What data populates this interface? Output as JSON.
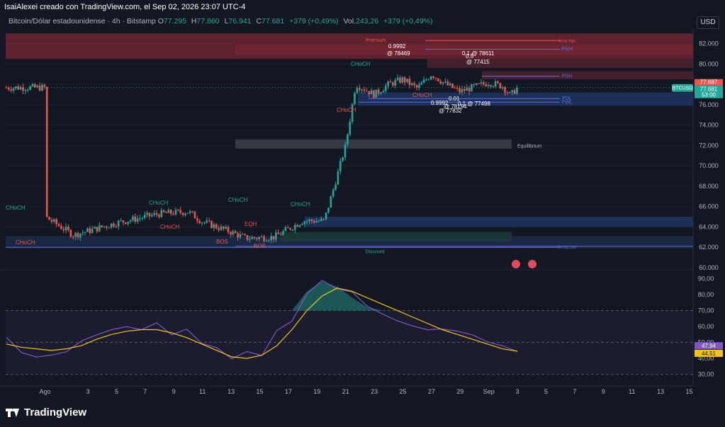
{
  "header": {
    "caption": "IsaiAlexei creado con TradingView.com, el Sep 02, 2026 23:07 UTC-4",
    "symbol": "Bitcoin/Dólar estadounidense · 4h · Bitstamp",
    "o_label": "O",
    "o_value": "77.295",
    "h_label": "H",
    "h_value": "77.860",
    "l_label": "L",
    "l_value": "76.941",
    "c_label": "C",
    "c_value": "77.681",
    "change": "+379 (+0,49%)",
    "vol_label": "Vol.",
    "vol_value": "243,26",
    "vol_change": "+379 (+0,49%)",
    "currency_button": "USD"
  },
  "colors": {
    "background": "#131722",
    "up": "#26a69a",
    "down": "#ef5350",
    "rsi_line": "#7e57c2",
    "rsi_ma": "#f0c419",
    "premium_zone": "#7a2631",
    "discount_zone": "#1c2b4a",
    "equilibrium_zone": "#3a3d46"
  },
  "chart_data": [
    {
      "type": "candlestick",
      "title": "BTCUSD 4h",
      "ylim": [
        60,
        83.5
      ],
      "y_ticks": [
        "82.000",
        "80.000",
        "78.000",
        "76.000",
        "74.000",
        "72.000",
        "70.000",
        "68.000",
        "66.000",
        "64.000",
        "62.000",
        "60.000"
      ],
      "x_ticks": [
        "Ago",
        "3",
        "5",
        "7",
        "9",
        "11",
        "13",
        "15",
        "17",
        "19",
        "21",
        "23",
        "25",
        "27",
        "29",
        "Sep",
        "3",
        "5",
        "7",
        "9",
        "11",
        "13",
        "15"
      ],
      "price_anchors": [
        [
          "Ago 0",
          65.0
        ],
        [
          "Ago 2",
          63.2
        ],
        [
          "Ago 5",
          64.4
        ],
        [
          "Ago 8",
          65.3
        ],
        [
          "Ago 10",
          65.5
        ],
        [
          "Ago 11",
          64.5
        ],
        [
          "Ago 13",
          63.5
        ],
        [
          "Ago 14",
          62.9
        ],
        [
          "Ago 16",
          63.0
        ],
        [
          "Ago 18",
          64.6
        ],
        [
          "Ago 19.5",
          64.6
        ],
        [
          "Ago 20",
          67.0
        ],
        [
          "Ago 21",
          72.0
        ],
        [
          "Ago 21.7",
          78.0
        ],
        [
          "Ago 23",
          77.0
        ],
        [
          "Ago 24",
          78.0
        ],
        [
          "Ago 25",
          78.5
        ],
        [
          "Ago 26",
          77.6
        ],
        [
          "Ago 27",
          79.0
        ],
        [
          "Ago 28",
          78.0
        ],
        [
          "Ago 29",
          77.3
        ],
        [
          "Sep 0",
          78.2
        ],
        [
          "Sep 1",
          77.8
        ],
        [
          "Sep 1.5",
          76.9
        ],
        [
          "Sep 2",
          77.68
        ]
      ],
      "last_price": "77.681",
      "last_price_label": "BTCUSD",
      "countdown": "53:00",
      "high_marker": "77.687",
      "zones": [
        {
          "name": "Premium",
          "from": 80.5,
          "to": 83.0
        },
        {
          "name": "Equilibrium",
          "from": 71.7,
          "to": 72.6
        },
        {
          "name": "Discount",
          "from": 61.9,
          "to": 63.1
        }
      ],
      "level_labels": [
        "Weak High",
        "PWH",
        "PDH",
        "PDL",
        "PWL",
        "Strong Low"
      ],
      "annotations": [
        "CHoCH",
        "CHoCH",
        "CHoCH",
        "CHoCH",
        "CHoCH",
        "CHoCH",
        "CHoCH",
        "CHoCH",
        "EQH",
        "BOS",
        "BOS",
        "0.9992",
        "@ 78469",
        "0.1 @ 78611",
        "0.5",
        "@ 77415",
        "0.9992",
        "@ 78194",
        "@ 77832",
        "0.01",
        "0.1 @ 77498"
      ]
    },
    {
      "type": "line",
      "title": "RSI",
      "ylim": [
        25,
        95
      ],
      "y_ticks": [
        "90,00",
        "80,00",
        "70,00",
        "60,00",
        "50,00",
        "40,00",
        "30,00"
      ],
      "band": [
        30,
        70
      ],
      "series": [
        {
          "values": [
            49,
            47,
            44,
            42,
            45,
            48,
            52,
            55,
            58,
            62,
            60,
            57,
            54,
            48,
            42,
            38,
            40,
            45,
            55,
            68,
            82,
            88,
            85,
            78,
            72,
            70,
            67,
            64,
            60,
            57,
            55,
            52,
            48,
            46,
            47.94
          ]
        },
        {
          "values": [
            49,
            47,
            46,
            45,
            46,
            48,
            52,
            55,
            57,
            58,
            58,
            56,
            53,
            49,
            45,
            41,
            40,
            42,
            48,
            58,
            70,
            79,
            84,
            82,
            78,
            74,
            70,
            66,
            62,
            58,
            55,
            52,
            49,
            46,
            44.51
          ]
        }
      ],
      "last_values": [
        "47,94",
        "44,51"
      ]
    }
  ],
  "footer": {
    "brand": "TradingView"
  }
}
